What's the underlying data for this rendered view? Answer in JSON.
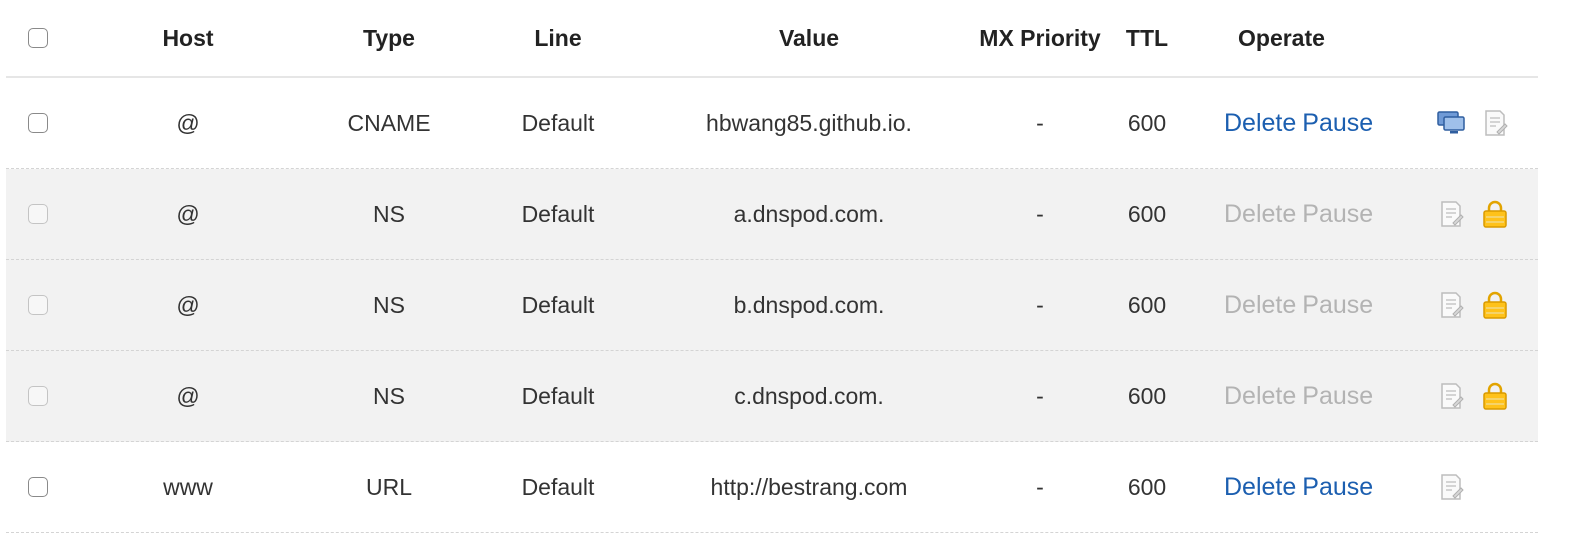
{
  "header": {
    "host": "Host",
    "type": "Type",
    "line": "Line",
    "value": "Value",
    "mx": "MX Priority",
    "ttl": "TTL",
    "operate": "Operate"
  },
  "records": [
    {
      "host": "@",
      "type": "CNAME",
      "line": "Default",
      "value": "hbwang85.github.io.",
      "mx": "-",
      "ttl": "600",
      "delete": "Delete",
      "pause": "Pause",
      "locked": false,
      "icons": [
        "monitor-icon",
        "note-icon"
      ]
    },
    {
      "host": "@",
      "type": "NS",
      "line": "Default",
      "value": "a.dnspod.com.",
      "mx": "-",
      "ttl": "600",
      "delete": "Delete",
      "pause": "Pause",
      "locked": true,
      "icons": [
        "note-icon",
        "lock-icon"
      ]
    },
    {
      "host": "@",
      "type": "NS",
      "line": "Default",
      "value": "b.dnspod.com.",
      "mx": "-",
      "ttl": "600",
      "delete": "Delete",
      "pause": "Pause",
      "locked": true,
      "icons": [
        "note-icon",
        "lock-icon"
      ]
    },
    {
      "host": "@",
      "type": "NS",
      "line": "Default",
      "value": "c.dnspod.com.",
      "mx": "-",
      "ttl": "600",
      "delete": "Delete",
      "pause": "Pause",
      "locked": true,
      "icons": [
        "note-icon",
        "lock-icon"
      ]
    },
    {
      "host": "www",
      "type": "URL",
      "line": "Default",
      "value": "http://bestrang.com",
      "mx": "-",
      "ttl": "600",
      "delete": "Delete",
      "pause": "Pause",
      "locked": false,
      "icons": [
        "note-icon"
      ]
    }
  ],
  "colors": {
    "link": "#1c5fb0",
    "disabled": "#b3b3b3",
    "locked_row": "#f2f2f2",
    "lock_icon": "#f0b400",
    "monitor_icon": "#3a6fb5"
  }
}
